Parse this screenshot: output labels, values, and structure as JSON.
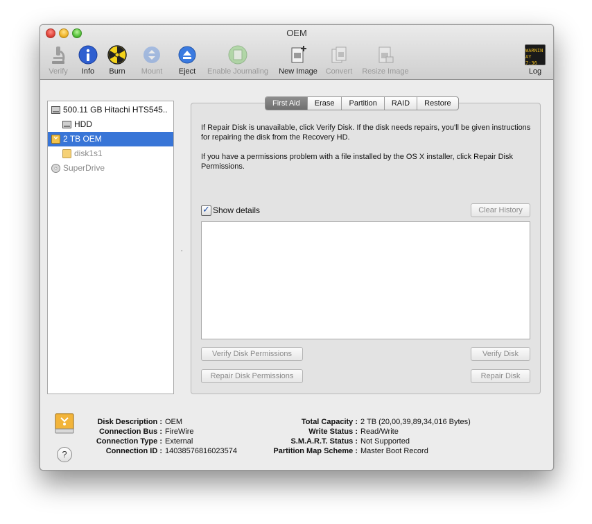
{
  "window": {
    "title": "OEM"
  },
  "toolbar": {
    "verify": {
      "label": "Verify",
      "icon": "microscope-icon"
    },
    "info": {
      "label": "Info",
      "icon": "info-icon"
    },
    "burn": {
      "label": "Burn",
      "icon": "burn-icon"
    },
    "mount": {
      "label": "Mount",
      "icon": "mount-icon"
    },
    "eject": {
      "label": "Eject",
      "icon": "eject-icon"
    },
    "journaling": {
      "label": "Enable Journaling",
      "icon": "journaling-icon"
    },
    "new_image": {
      "label": "New Image",
      "icon": "new-image-icon"
    },
    "convert": {
      "label": "Convert",
      "icon": "convert-icon"
    },
    "resize_image": {
      "label": "Resize Image",
      "icon": "resize-image-icon"
    },
    "log": {
      "label": "Log",
      "icon": "log-icon",
      "screen_text_1": "WARNIN",
      "screen_text_2": "AY 7:36"
    }
  },
  "sidebar": {
    "items": [
      {
        "label": "500.11 GB Hitachi HTS545..",
        "icon": "internal-disk-icon"
      },
      {
        "label": "HDD",
        "icon": "volume-icon"
      },
      {
        "label": "2 TB OEM",
        "icon": "external-disk-icon",
        "selected": true
      },
      {
        "label": "disk1s1",
        "icon": "external-volume-icon"
      },
      {
        "label": "SuperDrive",
        "icon": "superdrive-icon"
      }
    ]
  },
  "tabs": [
    "First Aid",
    "Erase",
    "Partition",
    "RAID",
    "Restore"
  ],
  "first_aid": {
    "paragraph1": "If Repair Disk is unavailable, click Verify Disk. If the disk needs repairs, you'll be given instructions for repairing the disk from the Recovery HD.",
    "paragraph2": "If you have a permissions problem with a file installed by the OS X installer, click Repair Disk Permissions.",
    "show_details_label": "Show details",
    "show_details_checked": true,
    "clear_history_label": "Clear History",
    "verify_permissions_label": "Verify Disk Permissions",
    "verify_disk_label": "Verify Disk",
    "repair_permissions_label": "Repair Disk Permissions",
    "repair_disk_label": "Repair Disk"
  },
  "disk_info": {
    "left": [
      {
        "key": "Disk Description :",
        "value": "OEM"
      },
      {
        "key": "Connection Bus :",
        "value": "FireWire"
      },
      {
        "key": "Connection Type :",
        "value": "External"
      },
      {
        "key": "Connection ID :",
        "value": "14038576816023574"
      }
    ],
    "right": [
      {
        "key": "Total Capacity :",
        "value": "2 TB (20,00,39,89,34,016 Bytes)"
      },
      {
        "key": "Write Status :",
        "value": "Read/Write"
      },
      {
        "key": "S.M.A.R.T. Status :",
        "value": "Not Supported"
      },
      {
        "key": "Partition Map Scheme :",
        "value": "Master Boot Record"
      }
    ]
  },
  "help_label": "?",
  "colors": {
    "selection": "#3875d7",
    "active_tab": "#7a7a7a"
  }
}
